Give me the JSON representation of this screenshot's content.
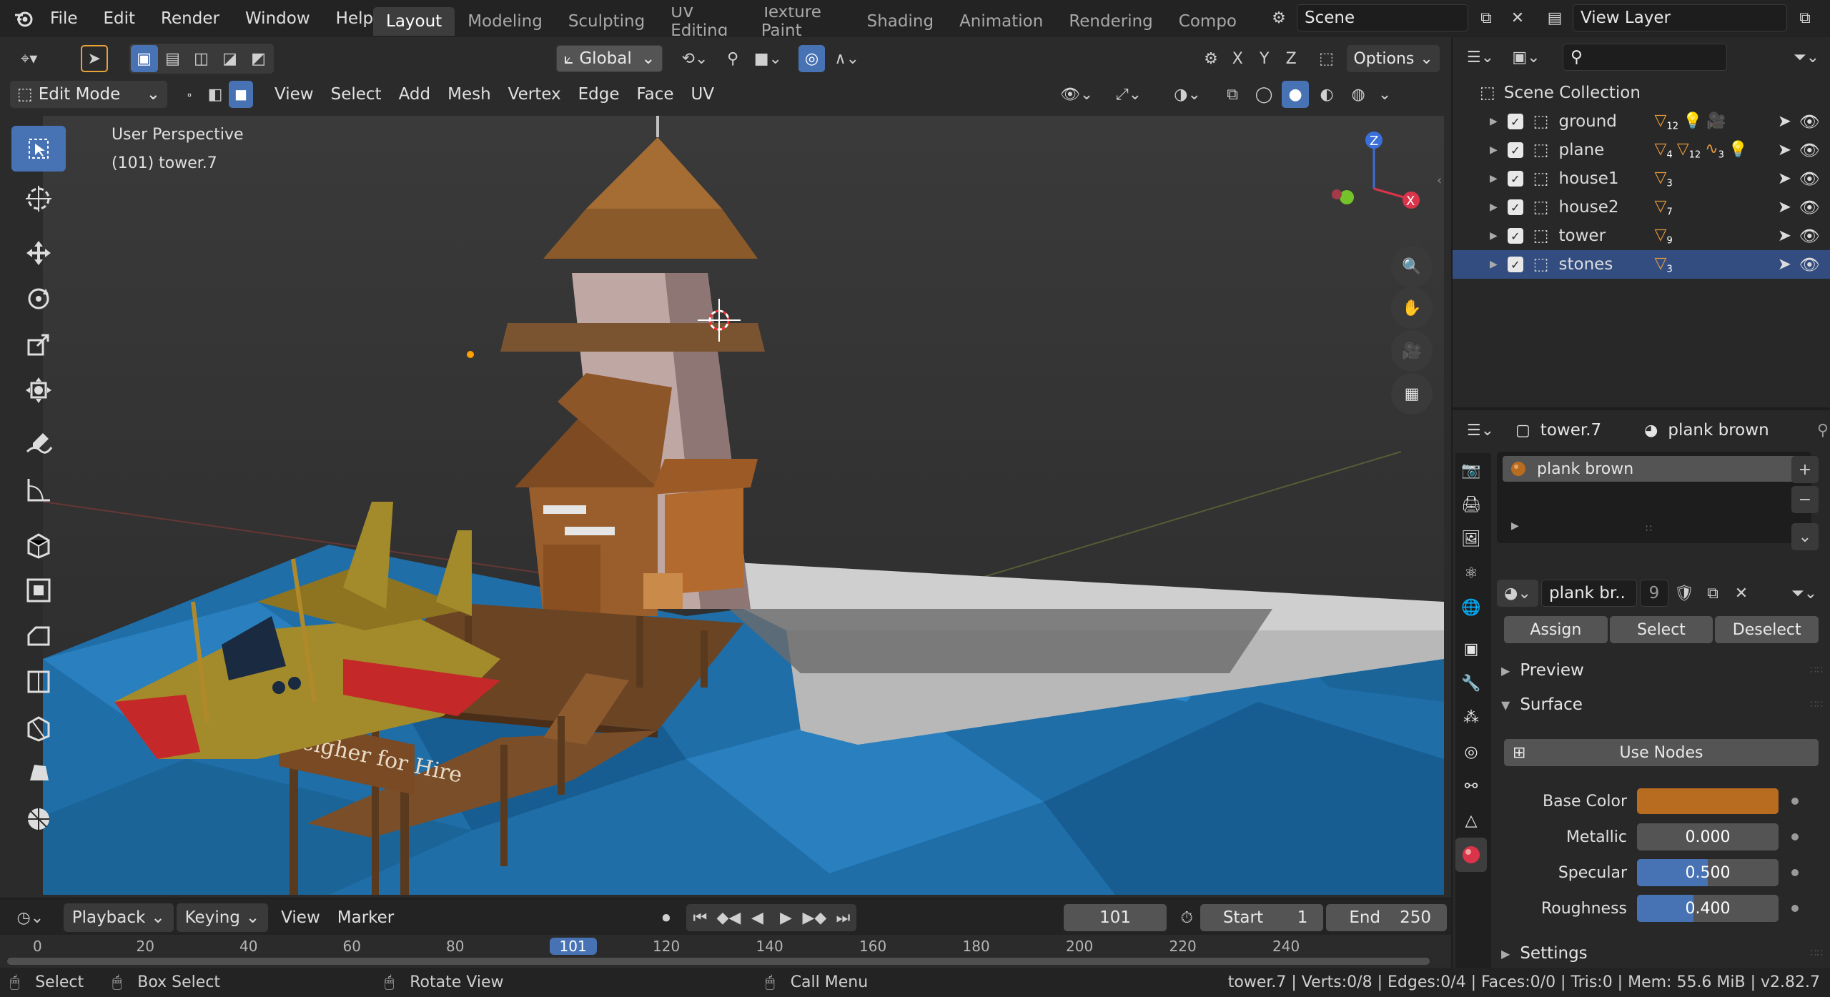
{
  "topbar": {
    "menus": [
      "File",
      "Edit",
      "Render",
      "Window",
      "Help"
    ],
    "workspaces": [
      "Layout",
      "Modeling",
      "Sculpting",
      "UV Editing",
      "Texture Paint",
      "Shading",
      "Animation",
      "Rendering",
      "Compo"
    ],
    "active_workspace": "Layout",
    "scene": "Scene",
    "view_layer": "View Layer"
  },
  "viewport_header": {
    "mode": "Edit Mode",
    "menus": [
      "View",
      "Select",
      "Add",
      "Mesh",
      "Vertex",
      "Edge",
      "Face",
      "UV"
    ],
    "orientation": "Global",
    "axes": [
      "X",
      "Y",
      "Z"
    ],
    "options": "Options"
  },
  "viewport": {
    "perspective": "User Perspective",
    "object_info": "(101) tower.7",
    "sign_text": "Heigher for Hire",
    "gizmo": {
      "x": "X",
      "z": "Z"
    }
  },
  "outliner": {
    "root": "Scene Collection",
    "items": [
      {
        "name": "ground",
        "badges": [
          {
            "icon": "mesh-icon",
            "count": "12"
          },
          {
            "icon": "light-icon"
          },
          {
            "icon": "camera-icon"
          }
        ]
      },
      {
        "name": "plane",
        "badges": [
          {
            "icon": "mesh-edit-icon",
            "count": "4"
          },
          {
            "icon": "mesh-icon",
            "count": "12"
          },
          {
            "icon": "curve-icon",
            "count": "3"
          },
          {
            "icon": "light-icon"
          }
        ]
      },
      {
        "name": "house1",
        "badges": [
          {
            "icon": "mesh-icon",
            "count": "3"
          }
        ]
      },
      {
        "name": "house2",
        "badges": [
          {
            "icon": "mesh-icon",
            "count": "7"
          }
        ]
      },
      {
        "name": "tower",
        "badges": [
          {
            "icon": "mesh-icon",
            "count": "9"
          }
        ]
      },
      {
        "name": "stones",
        "badges": [
          {
            "icon": "mesh-icon",
            "count": "3"
          }
        ],
        "selected": true
      }
    ]
  },
  "properties": {
    "object": "tower.7",
    "material": "plank brown",
    "slot": "plank brown",
    "material_field": "plank br..",
    "users": "9",
    "assign": "Assign",
    "select": "Select",
    "deselect": "Deselect",
    "preview": "Preview",
    "surface": "Surface",
    "use_nodes": "Use Nodes",
    "base_color_label": "Base Color",
    "base_color": "#b86c1f",
    "metallic_label": "Metallic",
    "metallic": "0.000",
    "metallic_fraction": 0,
    "specular_label": "Specular",
    "specular": "0.500",
    "specular_fraction": 0.5,
    "roughness_label": "Roughness",
    "roughness": "0.400",
    "roughness_fraction": 0.4,
    "settings": "Settings"
  },
  "timeline": {
    "playback": "Playback",
    "keying": "Keying",
    "view": "View",
    "marker": "Marker",
    "current_frame": "101",
    "start_label": "Start",
    "start": "1",
    "end_label": "End",
    "end": "250",
    "ticks": [
      "0",
      "20",
      "40",
      "60",
      "80",
      "101",
      "120",
      "140",
      "160",
      "180",
      "200",
      "220",
      "240"
    ]
  },
  "statusbar": {
    "select": "Select",
    "box_select": "Box Select",
    "rotate_view": "Rotate View",
    "call_menu": "Call Menu",
    "stats": "tower.7 | Verts:0/8 | Edges:0/4 | Faces:0/0 | Tris:0 | Mem: 55.6 MiB | v2.82.7"
  },
  "colors": {
    "accent": "#4772b3",
    "selected_row": "#334d80",
    "water": "#1f6ea8",
    "object_orange": "#e89a3c"
  }
}
